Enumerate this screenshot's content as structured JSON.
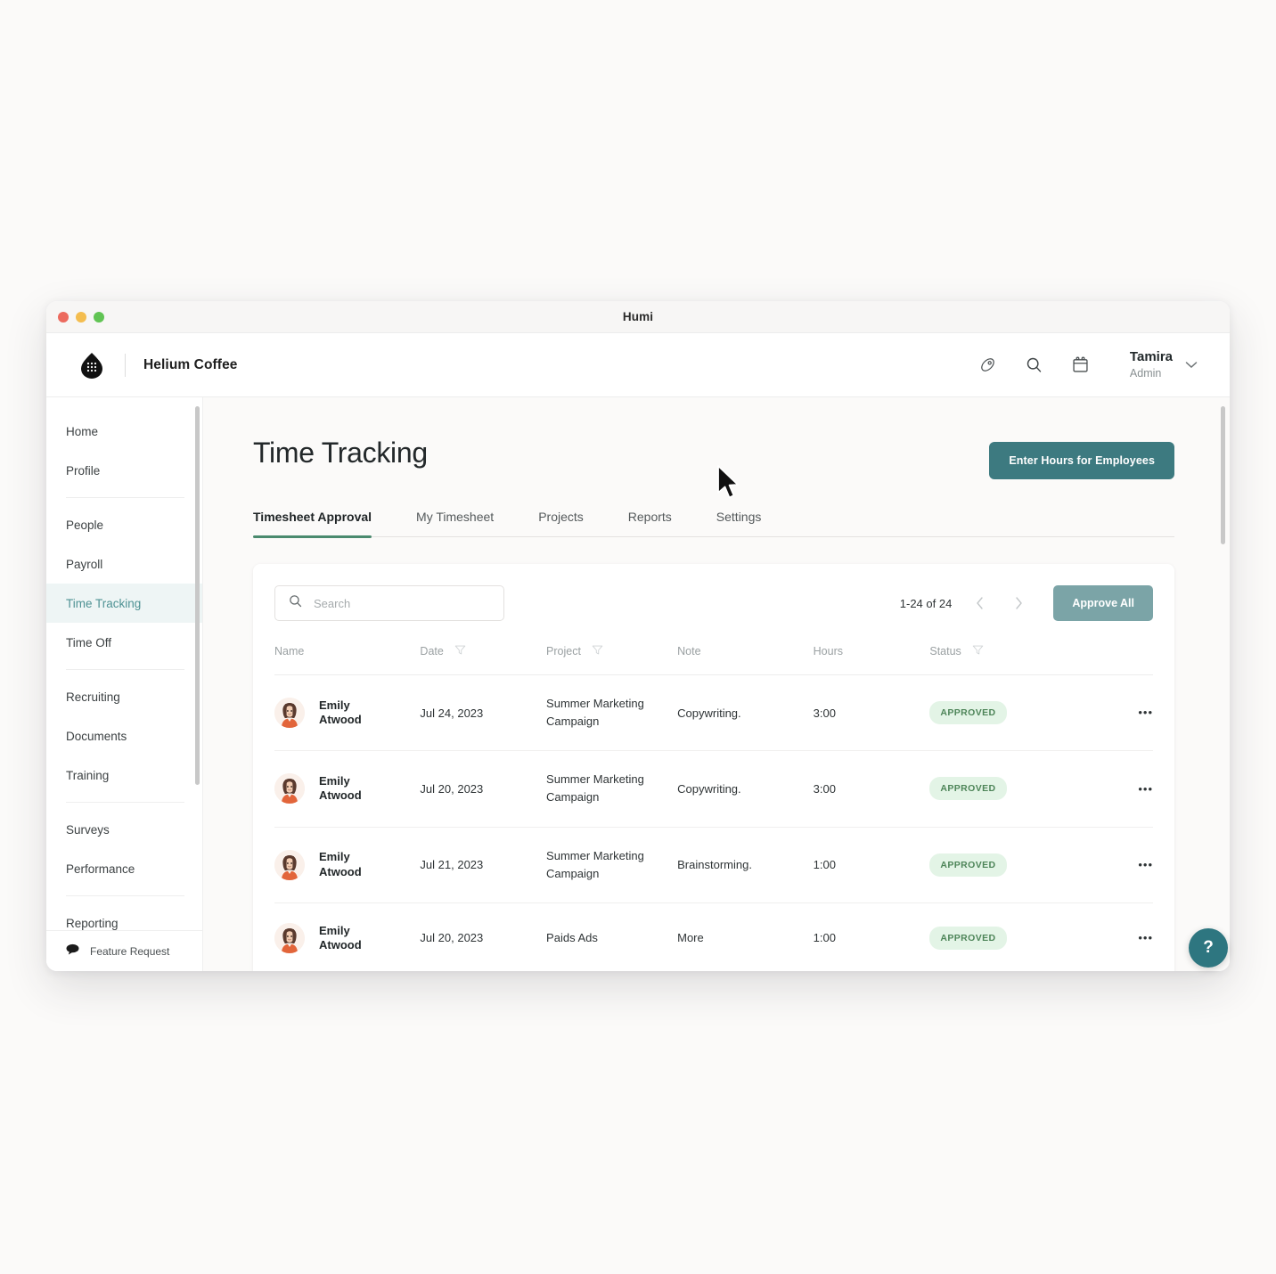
{
  "window": {
    "title": "Humi",
    "traffic_lights": [
      "close-red",
      "minimize-yellow",
      "maximize-green"
    ]
  },
  "header": {
    "logo_icon": "humi-droplet-logo",
    "company": "Helium Coffee",
    "icons": [
      {
        "name": "rocket-icon",
        "label": "Rocket"
      },
      {
        "name": "search-icon",
        "label": "Search"
      },
      {
        "name": "calendar-icon",
        "label": "Calendar"
      }
    ],
    "user": {
      "name": "Tamira",
      "role": "Admin",
      "chevron": "chevron-down-icon"
    }
  },
  "sidebar": {
    "groups": [
      {
        "items": [
          {
            "label": "Home",
            "active": false
          },
          {
            "label": "Profile",
            "active": false
          }
        ]
      },
      {
        "items": [
          {
            "label": "People",
            "active": false
          },
          {
            "label": "Payroll",
            "active": false
          },
          {
            "label": "Time Tracking",
            "active": true
          },
          {
            "label": "Time Off",
            "active": false
          }
        ]
      },
      {
        "items": [
          {
            "label": "Recruiting",
            "active": false
          },
          {
            "label": "Documents",
            "active": false
          },
          {
            "label": "Training",
            "active": false
          }
        ]
      },
      {
        "items": [
          {
            "label": "Surveys",
            "active": false
          },
          {
            "label": "Performance",
            "active": false
          }
        ]
      },
      {
        "items": [
          {
            "label": "Reporting",
            "active": false
          }
        ]
      }
    ],
    "footer": {
      "icon": "speech-bubble-icon",
      "label": "Feature Request"
    }
  },
  "main": {
    "page_title": "Time Tracking",
    "primary_button": "Enter Hours for Employees",
    "tabs": [
      {
        "label": "Timesheet Approval",
        "active": true
      },
      {
        "label": "My Timesheet",
        "active": false
      },
      {
        "label": "Projects",
        "active": false
      },
      {
        "label": "Reports",
        "active": false
      },
      {
        "label": "Settings",
        "active": false
      }
    ],
    "toolbar": {
      "search_placeholder": "Search",
      "search_value": "",
      "pagination": "1-24 of 24",
      "prev_icon": "chevron-left-icon",
      "next_icon": "chevron-right-icon",
      "approve_all": "Approve All"
    },
    "table": {
      "columns": [
        {
          "label": "Name",
          "filter": false
        },
        {
          "label": "Date",
          "filter": true
        },
        {
          "label": "Project",
          "filter": true
        },
        {
          "label": "Note",
          "filter": false
        },
        {
          "label": "Hours",
          "filter": false
        },
        {
          "label": "Status",
          "filter": true
        },
        {
          "label": "",
          "filter": false
        }
      ],
      "rows": [
        {
          "name": "Emily Atwood",
          "date": "Jul 24, 2023",
          "project": "Summer Marketing Campaign",
          "note": "Copywriting.",
          "hours": "3:00",
          "status": "APPROVED",
          "actions": "row-actions-menu"
        },
        {
          "name": "Emily Atwood",
          "date": "Jul 20, 2023",
          "project": "Summer Marketing Campaign",
          "note": "Copywriting.",
          "hours": "3:00",
          "status": "APPROVED",
          "actions": "row-actions-menu"
        },
        {
          "name": "Emily Atwood",
          "date": "Jul 21, 2023",
          "project": "Summer Marketing Campaign",
          "note": "Brainstorming.",
          "hours": "1:00",
          "status": "APPROVED",
          "actions": "row-actions-menu"
        },
        {
          "name": "Emily Atwood",
          "date": "Jul 20, 2023",
          "project": "Paids Ads",
          "note": "More",
          "hours": "1:00",
          "status": "APPROVED",
          "actions": "row-actions-menu"
        }
      ]
    }
  },
  "help_button": "?",
  "colors": {
    "accent_teal": "#3d7a80",
    "approve_teal": "#7ba4a7",
    "active_nav_teal": "#4f9294",
    "active_nav_bg": "#eef5f5",
    "tab_underline_green": "#4a8a6e",
    "badge_bg": "#e3f4e6",
    "badge_text": "#4e8559",
    "help_fab": "#2e7680",
    "page_bg": "#fbfaf9"
  }
}
